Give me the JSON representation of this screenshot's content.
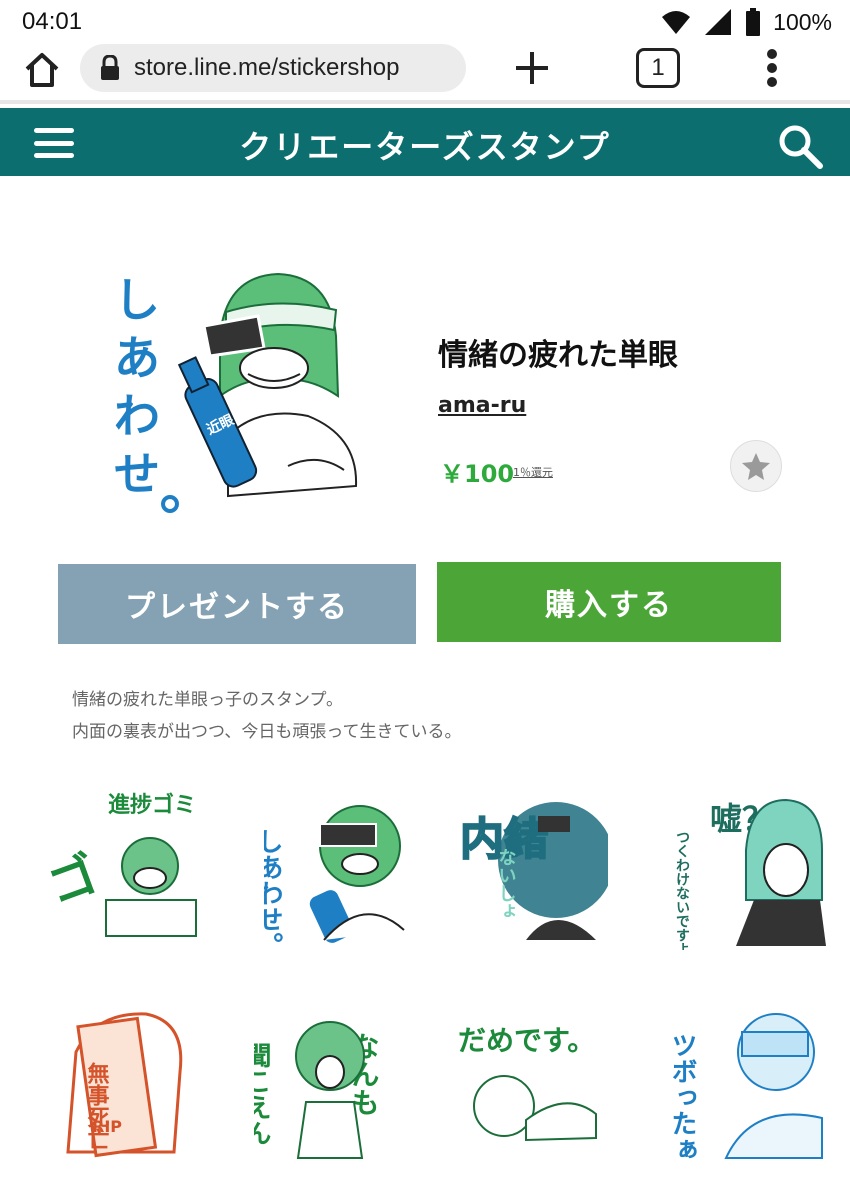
{
  "status": {
    "time": "04:01",
    "battery": "100%"
  },
  "browser": {
    "url": "store.line.me/stickershop",
    "tab_count": "1"
  },
  "header": {
    "title": "クリエーターズスタンプ"
  },
  "product": {
    "title": "情緒の疲れた単眼",
    "author": "ama-ru",
    "price": "￥100",
    "cashback": "1％還元",
    "present_label": "プレゼントする",
    "buy_label": "購入する",
    "description": [
      "情緒の疲れた単眼っ子のスタンプ。",
      "内面の裏表が出つつ、今日も頑張って生きている。"
    ]
  },
  "main_sticker": {
    "text": "しあわせ。",
    "bottle_text": "近眼"
  },
  "stickers": [
    {
      "text": "進捗ゴミ"
    },
    {
      "text": "しあわせ。"
    },
    {
      "text": "内緒",
      "sub": "ないしょ"
    },
    {
      "text": "嘘？",
      "sub": "つくわけないですよぉ"
    },
    {
      "text": "無事死亡",
      "sub": "RIP"
    },
    {
      "text": "聞こえん",
      "sub": "なんも"
    },
    {
      "text": "だめです。"
    },
    {
      "text": "ツボったぁ"
    }
  ],
  "colors": {
    "header": "#0c6e6e",
    "buy": "#4ca637",
    "present": "#84a2b3",
    "price": "#2eaa3c"
  }
}
